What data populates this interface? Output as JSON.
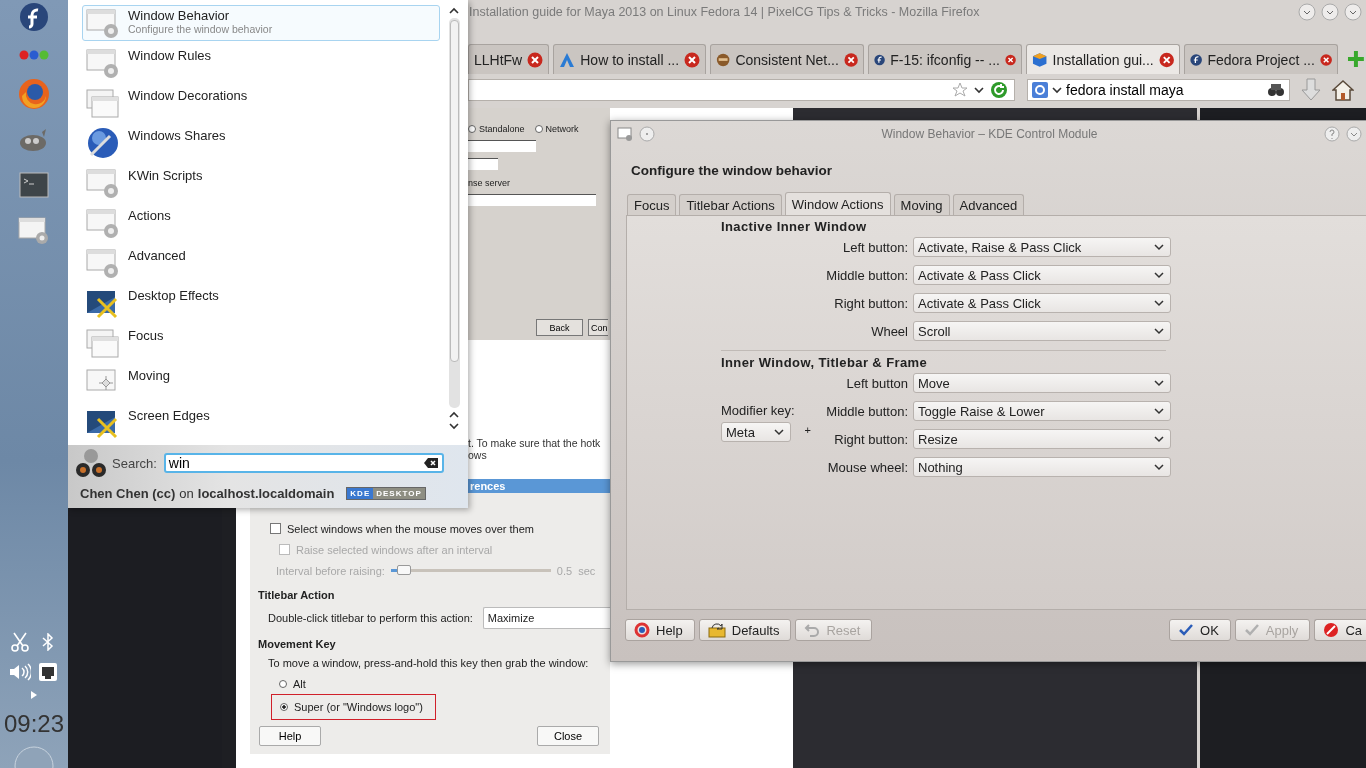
{
  "panel": {
    "clock": "09:23"
  },
  "browser": {
    "title": "Installation guide for Maya 2013 on Linux Fedora 14 | PixelCG Tips & Tricks - Mozilla Firefox",
    "tabs": [
      {
        "label": "LLHtFw",
        "kind": "plain",
        "selected": false
      },
      {
        "label": "How to install ...",
        "kind": "triangle",
        "selected": false
      },
      {
        "label": "Consistent Net...",
        "kind": "face",
        "selected": false
      },
      {
        "label": "F-15: ifconfig -- ...",
        "kind": "fedora",
        "selected": false
      },
      {
        "label": "Installation gui...",
        "kind": "cube",
        "selected": true
      },
      {
        "label": "Fedora Project ...",
        "kind": "fedora",
        "selected": false
      }
    ],
    "search_query": "fedora install maya",
    "page": {
      "installer": {
        "radios": [
          {
            "label": "Standalone",
            "selected": false
          },
          {
            "label": "Network",
            "selected": false
          }
        ],
        "field_label": "nse server",
        "buttons": [
          "Back",
          "Con"
        ]
      },
      "note_lines": [
        "t. To make sure that the hotk",
        "ows"
      ],
      "dialog": {
        "header": "rences",
        "checks": [
          {
            "label": "Select windows when the mouse moves over them",
            "checked": false,
            "disabled": false
          },
          {
            "label": "Raise selected windows after an interval",
            "checked": false,
            "disabled": true
          }
        ],
        "interval": {
          "label": "Interval before raising:",
          "level": 0.05,
          "reading": "0.5",
          "unit": "sec"
        },
        "titlebar_heading": "Titlebar Action",
        "titlebar_label": "Double-click titlebar to perform this action:",
        "titlebar_value": "Maximize",
        "movement_heading": "Movement Key",
        "movement_text": "To move a window, press-and-hold this key then grab the window:",
        "options": [
          {
            "label": "Alt",
            "selected": false,
            "highlighted": false
          },
          {
            "label": "Super (or \"Windows logo\")",
            "selected": true,
            "highlighted": true
          }
        ],
        "buttons": [
          "Help",
          "Close"
        ]
      }
    }
  },
  "launcher": {
    "results": [
      {
        "title": "Window Behavior",
        "subtitle": "Configure the window behavior",
        "kind": "module",
        "selected": true
      },
      {
        "title": "Window Rules",
        "kind": "module",
        "selected": false
      },
      {
        "title": "Window Decorations",
        "kind": "windows",
        "selected": false
      },
      {
        "title": "Windows Shares",
        "kind": "network",
        "selected": false
      },
      {
        "title": "KWin Scripts",
        "kind": "module",
        "selected": false
      },
      {
        "title": "Actions",
        "kind": "module",
        "selected": false
      },
      {
        "title": "Advanced",
        "kind": "module",
        "selected": false
      },
      {
        "title": "Desktop Effects",
        "kind": "tools",
        "selected": false
      },
      {
        "title": "Focus",
        "kind": "windows",
        "selected": false
      },
      {
        "title": "Moving",
        "kind": "move",
        "selected": false
      },
      {
        "title": "Screen Edges",
        "kind": "tools",
        "selected": false
      }
    ],
    "search_label": "Search:",
    "search_value": "win",
    "user": "Chen Chen (cc)",
    "user_on": "on",
    "host": "localhost.localdomain",
    "badge": [
      "KDE",
      "DESKTOP"
    ]
  },
  "kcm": {
    "title": "Window Behavior – KDE Control Module",
    "heading": "Configure the window behavior",
    "tabs": [
      {
        "label": "Focus",
        "selected": false
      },
      {
        "label": "Titlebar Actions",
        "selected": false
      },
      {
        "label": "Window Actions",
        "selected": true
      },
      {
        "label": "Moving",
        "selected": false
      },
      {
        "label": "Advanced",
        "selected": false
      }
    ],
    "sections": [
      {
        "title": "Inactive Inner Window",
        "rows": [
          {
            "label": "Left button:",
            "value": "Activate, Raise & Pass Click"
          },
          {
            "label": "Middle button:",
            "value": "Activate & Pass Click"
          },
          {
            "label": "Right button:",
            "value": "Activate & Pass Click"
          },
          {
            "label": "Wheel",
            "value": "Scroll"
          }
        ]
      },
      {
        "title": "Inner Window, Titlebar & Frame",
        "modifier": {
          "label": "Modifier key:",
          "value": "Meta",
          "plus": "+"
        },
        "rows": [
          {
            "label": "Left button",
            "value": "Move"
          },
          {
            "label": "Middle button:",
            "value": "Toggle Raise & Lower"
          },
          {
            "label": "Right button:",
            "value": "Resize"
          },
          {
            "label": "Mouse wheel:",
            "value": "Nothing"
          }
        ]
      }
    ],
    "buttons": [
      {
        "label": "Help",
        "kind": "help",
        "disabled": false
      },
      {
        "label": "Defaults",
        "kind": "defaults",
        "disabled": false
      },
      {
        "label": "Reset",
        "kind": "reset",
        "disabled": true
      },
      {
        "label": "OK",
        "kind": "ok",
        "disabled": false
      },
      {
        "label": "Apply",
        "kind": "ok",
        "disabled": true
      },
      {
        "label": "Ca",
        "kind": "cancel",
        "disabled": false
      }
    ]
  }
}
